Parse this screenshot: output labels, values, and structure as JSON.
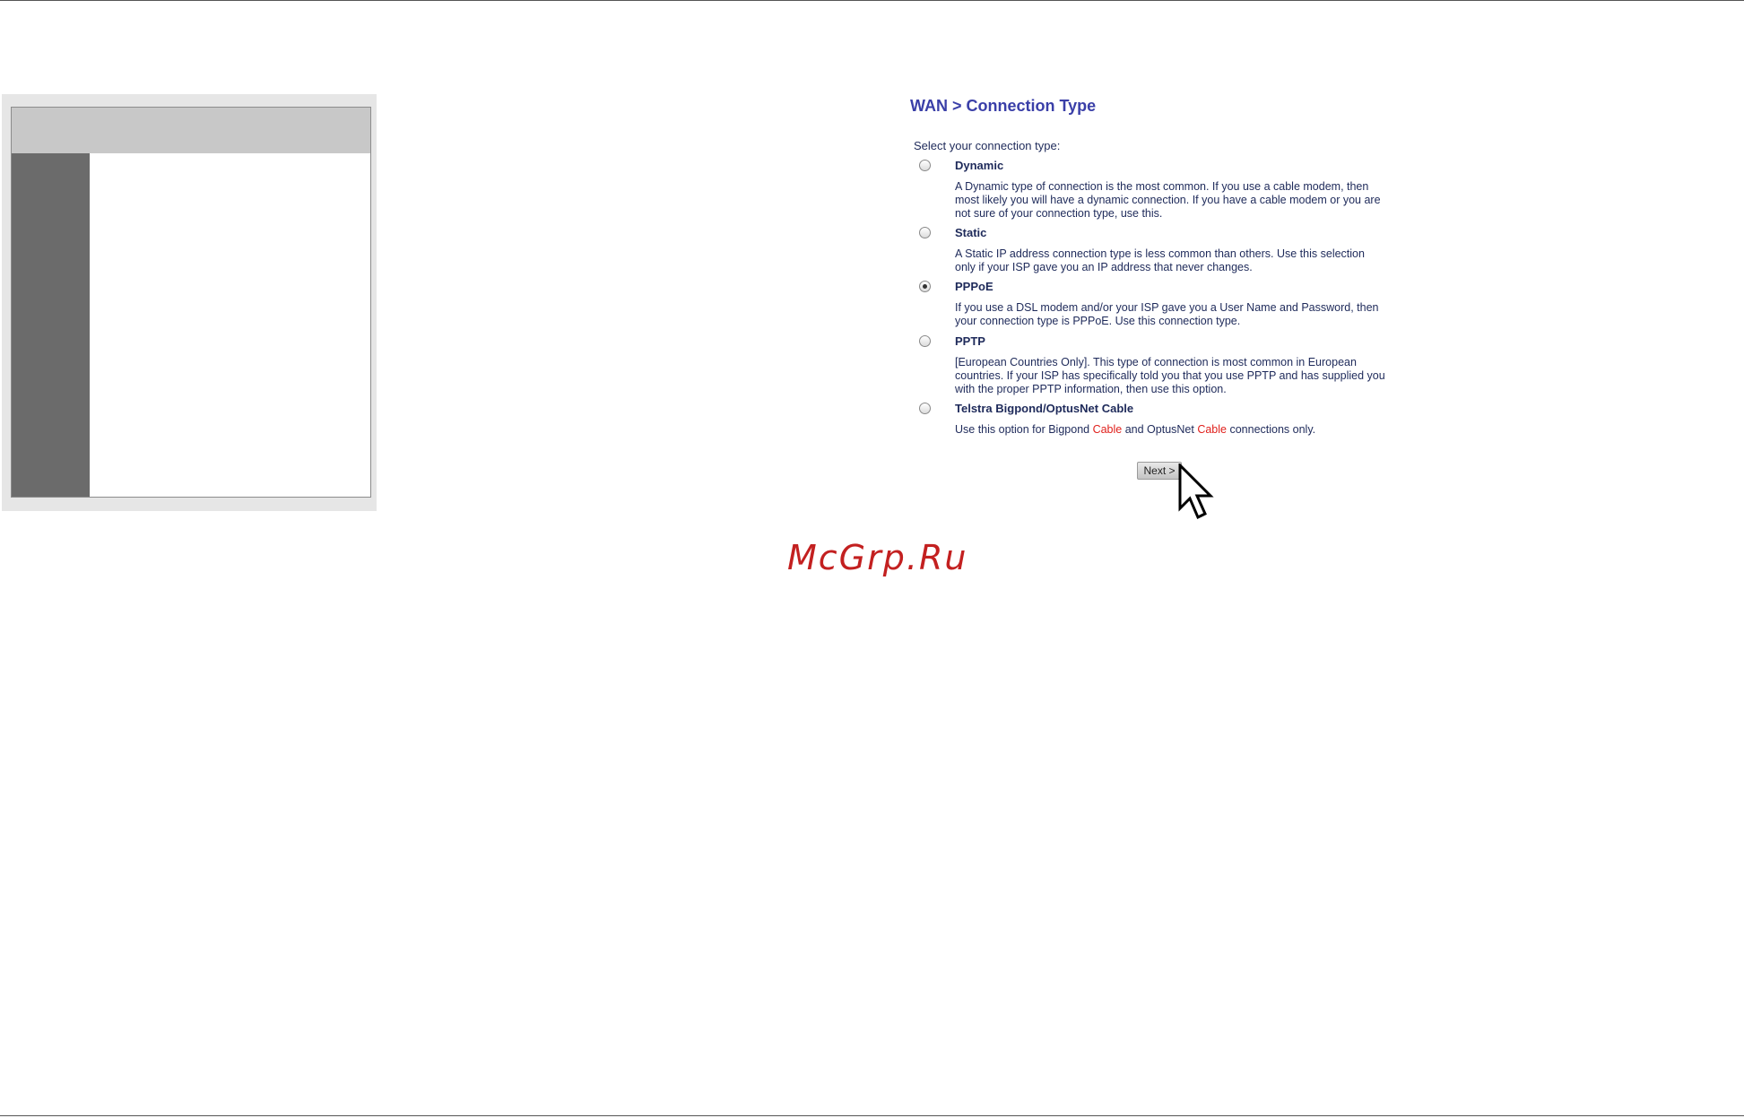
{
  "title": "WAN > Connection Type",
  "prompt": "Select your connection type:",
  "options": [
    {
      "label": "Dynamic",
      "selected": false,
      "desc": "A Dynamic type of connection is the most common. If you use a cable modem, then most likely you will have a dynamic connection. If you have a cable modem or you are not sure of your connection type, use this."
    },
    {
      "label": "Static",
      "selected": false,
      "desc": "A Static IP address connection type is less common than others. Use this selection only if your ISP gave you an IP address that never changes."
    },
    {
      "label": "PPPoE",
      "selected": true,
      "desc": "If you use a DSL modem and/or your ISP gave you a User Name and Password, then your connection type is PPPoE. Use this connection type."
    },
    {
      "label": "PPTP",
      "selected": false,
      "desc": "[European Countries Only]. This type of connection is most common in European countries. If your ISP has specifically told you that you use PPTP and has supplied you with the proper PPTP information, then use this option."
    },
    {
      "label": "Telstra Bigpond/OptusNet Cable",
      "selected": false,
      "desc_parts": [
        "Use this option for Bigpond ",
        "Cable",
        " and OptusNet ",
        "Cable",
        " connections only."
      ]
    }
  ],
  "next_button": "Next >",
  "watermark": "McGrp.Ru",
  "colors": {
    "title": "#3a3fa8",
    "text": "#1e2a5a",
    "highlight": "#e0201c",
    "watermark": "#c32020"
  }
}
